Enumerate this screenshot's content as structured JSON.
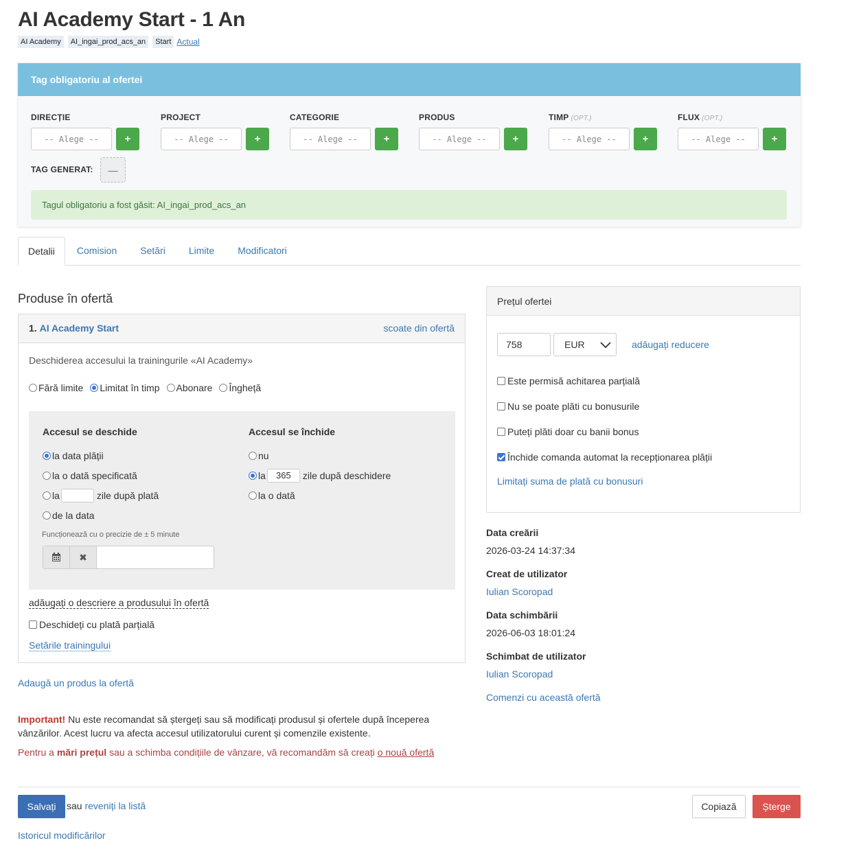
{
  "page_title": "AI Academy Start - 1 An",
  "tags": [
    "AI Academy",
    "AI_ingai_prod_acs_an",
    "Start"
  ],
  "tag_link": "Actual",
  "mandatory": {
    "header": "Tag obligatoriu al ofertei",
    "fields": [
      {
        "label": "DIRECȚIE",
        "optional": "",
        "placeholder": "-- Alege --"
      },
      {
        "label": "PROJECT",
        "optional": "",
        "placeholder": "-- Alege --"
      },
      {
        "label": "CATEGORIE",
        "optional": "",
        "placeholder": "-- Alege --"
      },
      {
        "label": "PRODUS",
        "optional": "",
        "placeholder": "-- Alege --"
      },
      {
        "label": "TIMP",
        "optional": "(OPT.)",
        "placeholder": "-- Alege --"
      },
      {
        "label": "FLUX",
        "optional": "(OPT.)",
        "placeholder": "-- Alege --"
      }
    ],
    "add_symbol": "+",
    "generated_label": "TAG GENERAT:",
    "generated_value": "—",
    "success_message": "Tagul obligatoriu a fost găsit: AI_ingai_prod_acs_an"
  },
  "tabs": [
    "Detalii",
    "Comision",
    "Setări",
    "Limite",
    "Modificatori"
  ],
  "products": {
    "section_title": "Produse în ofertă",
    "index": "1.",
    "name": "AI Academy Start",
    "remove_link": "scoate din ofertă",
    "description": "Deschiderea accesului la trainingurile «AI Academy»",
    "modes": [
      {
        "label": "Fără limite",
        "checked": false
      },
      {
        "label": "Limitat în timp",
        "checked": true
      },
      {
        "label": "Abonare",
        "checked": false
      },
      {
        "label": "Îngheță",
        "checked": false
      }
    ],
    "open": {
      "title": "Accesul se deschide",
      "opt1": "la data plății",
      "opt2": "la o dată specificată",
      "opt3_pre": "la",
      "opt3_value": "",
      "opt3_post": "zile după plată",
      "opt4": "de la data"
    },
    "close": {
      "title": "Accesul se închide",
      "opt1": "nu",
      "opt2_pre": "la",
      "opt2_value": "365",
      "opt2_post": "zile după deschidere",
      "opt3": "la o dată"
    },
    "precision_note": "Funcționează cu o precizie de ± 5 minute",
    "date_value": "",
    "add_description": "adăugați o descriere a produsului în ofertă",
    "partial_open": "Deschideți cu plată parțială",
    "training_settings": "Setările trainingului",
    "add_product": "Adaugă un produs la ofertă"
  },
  "warnings": {
    "important_label": "Important!",
    "important_text": " Nu este recomandat să ștergeți sau să modificați produsul și ofertele după începerea vânzărilor. Acest lucru va afecta accesul utilizatorului curent și comenzile existente.",
    "price_pre": "Pentru a ",
    "price_bold": "mări prețul",
    "price_mid": " sau a schimba condițiile de vânzare, vă recomandăm să creați ",
    "price_link": "o nouă ofertă"
  },
  "price": {
    "header": "Prețul ofertei",
    "value": "758",
    "currency": "EUR",
    "discount_link": "adăugați reducere",
    "checks": [
      {
        "label": "Este permisă achitarea parțială",
        "checked": false
      },
      {
        "label": "Nu se poate plăti cu bonusurile",
        "checked": false
      },
      {
        "label": "Puteți plăti doar cu banii bonus",
        "checked": false
      },
      {
        "label": "Închide comanda automat la recepționarea plății",
        "checked": true
      }
    ],
    "limit_link": "Limitați suma de plată cu bonusuri"
  },
  "meta": {
    "created_label": "Data creării",
    "created_value": "2026-03-24 14:37:34",
    "creator_label": "Creat de utilizator",
    "creator_value": "Iulian Scoropad",
    "changed_label": "Data schimbării",
    "changed_value": "2026-06-03 18:01:24",
    "changer_label": "Schimbat de utilizator",
    "changer_value": "Iulian Scoropad",
    "orders_link": "Comenzi cu această ofertă"
  },
  "footer": {
    "save": "Salvați",
    "or": "sau ",
    "back": "reveniți la listă",
    "copy": "Copiază",
    "delete": "Șterge",
    "history": "Istoricul modificărilor"
  }
}
